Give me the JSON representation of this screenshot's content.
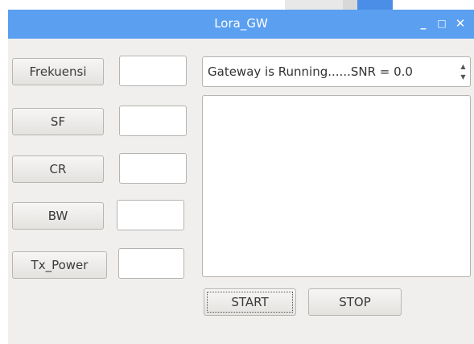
{
  "window": {
    "title": "Lora_GW",
    "controls": {
      "minimize": "_",
      "maximize": "□",
      "close": "✕"
    }
  },
  "parameters": {
    "frekuensi_label": "Frekuensi",
    "sf_label": "SF",
    "cr_label": "CR",
    "bw_label": "BW",
    "tx_power_label": "Tx_Power"
  },
  "status": {
    "text": "Gateway is Running......SNR = 0.0"
  },
  "actions": {
    "start_label": "START",
    "stop_label": "STOP"
  },
  "colors": {
    "titlebar": "#5b9ff0",
    "background": "#f0efed"
  }
}
